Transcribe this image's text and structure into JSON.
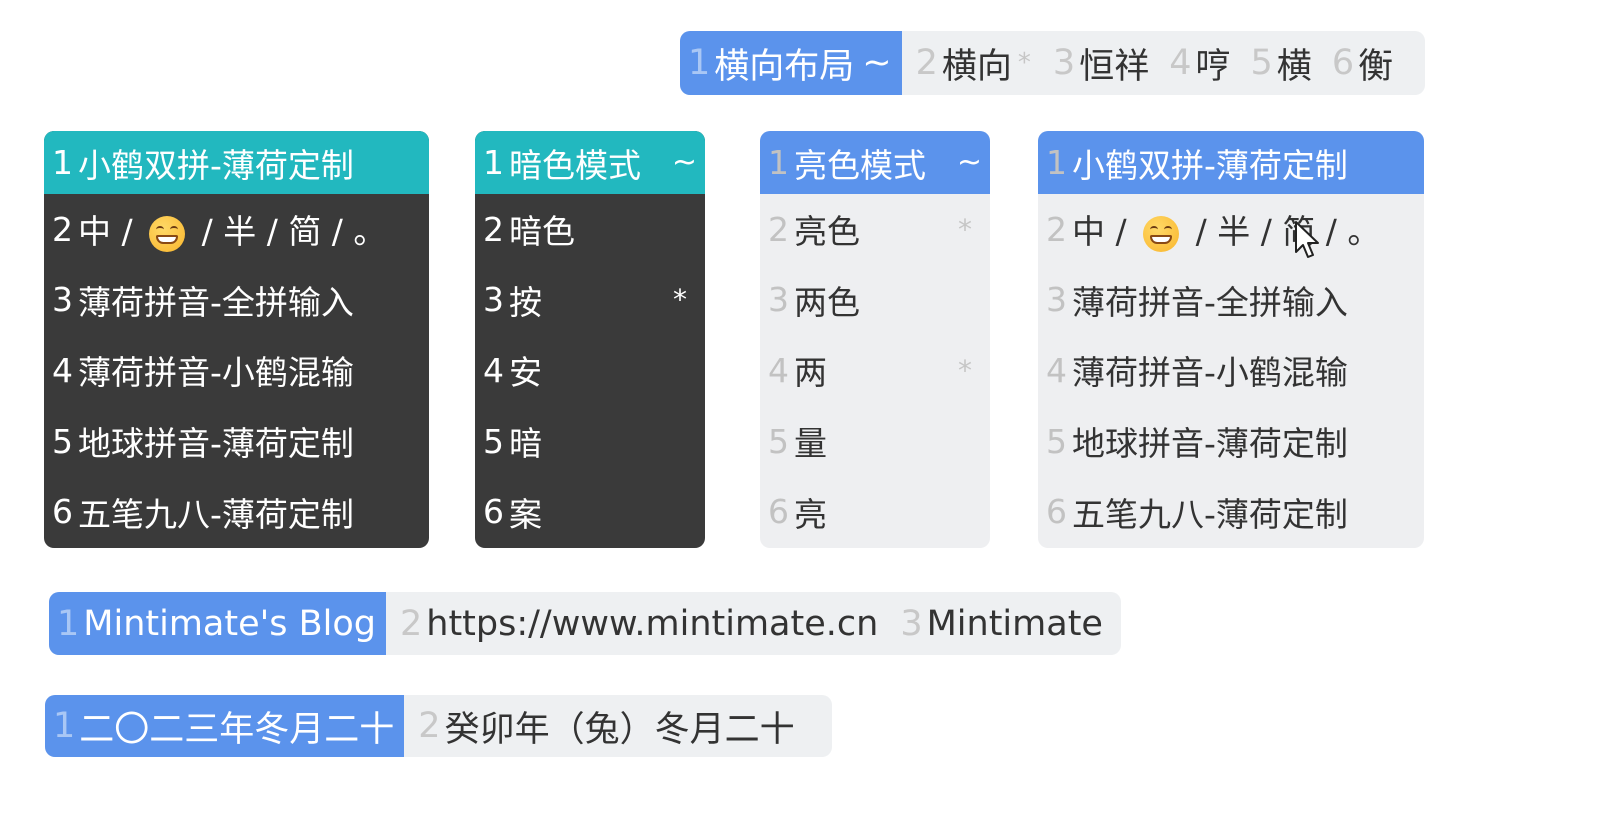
{
  "top_bar": {
    "items": [
      {
        "num": "1",
        "text": "横向布局",
        "mark": "~"
      },
      {
        "num": "2",
        "text": "横向",
        "mark": "*"
      },
      {
        "num": "3",
        "text": "恒祥",
        "mark": ""
      },
      {
        "num": "4",
        "text": "哼",
        "mark": ""
      },
      {
        "num": "5",
        "text": "横",
        "mark": ""
      },
      {
        "num": "6",
        "text": "衡",
        "mark": ""
      }
    ]
  },
  "dark_list_1": {
    "head": {
      "num": "1",
      "text": "小鹤双拼-薄荷定制"
    },
    "row2": {
      "num": "2",
      "a": "中 /",
      "b": "/ 半 / 简 / 。"
    },
    "rows": [
      {
        "num": "3",
        "text": "薄荷拼音-全拼输入"
      },
      {
        "num": "4",
        "text": "薄荷拼音-小鹤混输"
      },
      {
        "num": "5",
        "text": "地球拼音-薄荷定制"
      },
      {
        "num": "6",
        "text": "五笔九八-薄荷定制"
      }
    ]
  },
  "dark_list_2": {
    "head": {
      "num": "1",
      "text": "暗色模式",
      "mark": "~"
    },
    "rows": [
      {
        "num": "2",
        "text": "暗色",
        "mark": ""
      },
      {
        "num": "3",
        "text": "按",
        "mark": "*"
      },
      {
        "num": "4",
        "text": "安",
        "mark": ""
      },
      {
        "num": "5",
        "text": "暗",
        "mark": ""
      },
      {
        "num": "6",
        "text": "案",
        "mark": ""
      }
    ]
  },
  "light_list_1": {
    "head": {
      "num": "1",
      "text": "亮色模式",
      "mark": "~"
    },
    "rows": [
      {
        "num": "2",
        "text": "亮色",
        "mark": "*"
      },
      {
        "num": "3",
        "text": "两色",
        "mark": ""
      },
      {
        "num": "4",
        "text": "两",
        "mark": "*"
      },
      {
        "num": "5",
        "text": "量",
        "mark": ""
      },
      {
        "num": "6",
        "text": "亮",
        "mark": ""
      }
    ]
  },
  "light_list_2": {
    "head": {
      "num": "1",
      "text": "小鹤双拼-薄荷定制"
    },
    "row2": {
      "num": "2",
      "a": "中 /",
      "b": "/ 半 / 简 / 。"
    },
    "rows": [
      {
        "num": "3",
        "text": "薄荷拼音-全拼输入"
      },
      {
        "num": "4",
        "text": "薄荷拼音-小鹤混输"
      },
      {
        "num": "5",
        "text": "地球拼音-薄荷定制"
      },
      {
        "num": "6",
        "text": "五笔九八-薄荷定制"
      }
    ]
  },
  "blog_bar": {
    "items": [
      {
        "num": "1",
        "text": "Mintimate's Blog"
      },
      {
        "num": "2",
        "text": "https://www.mintimate.cn"
      },
      {
        "num": "3",
        "text": "Mintimate"
      }
    ]
  },
  "date_bar": {
    "items": [
      {
        "num": "1",
        "text": "二〇二三年冬月二十"
      },
      {
        "num": "2",
        "text": "癸卯年（兔）冬月二十"
      }
    ]
  },
  "colors": {
    "accent_blue": "#5b93ec",
    "accent_teal": "#22b8bf",
    "dark_bg": "#3a3a3a",
    "light_bg": "#eeeff1"
  },
  "icons": {
    "emoji": "grinning-face-icon",
    "cursor": "mouse-pointer-icon"
  }
}
